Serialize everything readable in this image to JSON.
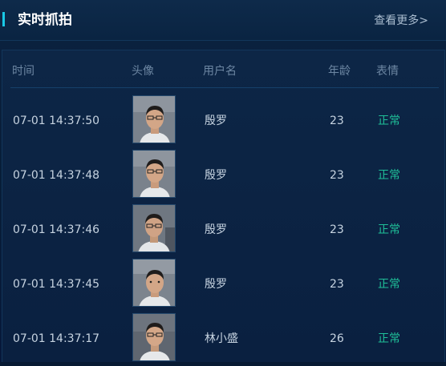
{
  "header": {
    "title": "实时抓拍",
    "more_label": "查看更多>"
  },
  "table": {
    "columns": [
      "时间",
      "头像",
      "用户名",
      "年龄",
      "表情"
    ],
    "rows": [
      {
        "time": "07-01 14:37:50",
        "name": "殷罗",
        "age": "23",
        "expression": "正常"
      },
      {
        "time": "07-01 14:37:48",
        "name": "殷罗",
        "age": "23",
        "expression": "正常"
      },
      {
        "time": "07-01 14:37:46",
        "name": "殷罗",
        "age": "23",
        "expression": "正常"
      },
      {
        "time": "07-01 14:37:45",
        "name": "殷罗",
        "age": "23",
        "expression": "正常"
      },
      {
        "time": "07-01 14:37:17",
        "name": "林小盛",
        "age": "26",
        "expression": "正常"
      }
    ]
  },
  "colors": {
    "accent": "#19c8e6",
    "expression_normal": "#1fbf98"
  }
}
